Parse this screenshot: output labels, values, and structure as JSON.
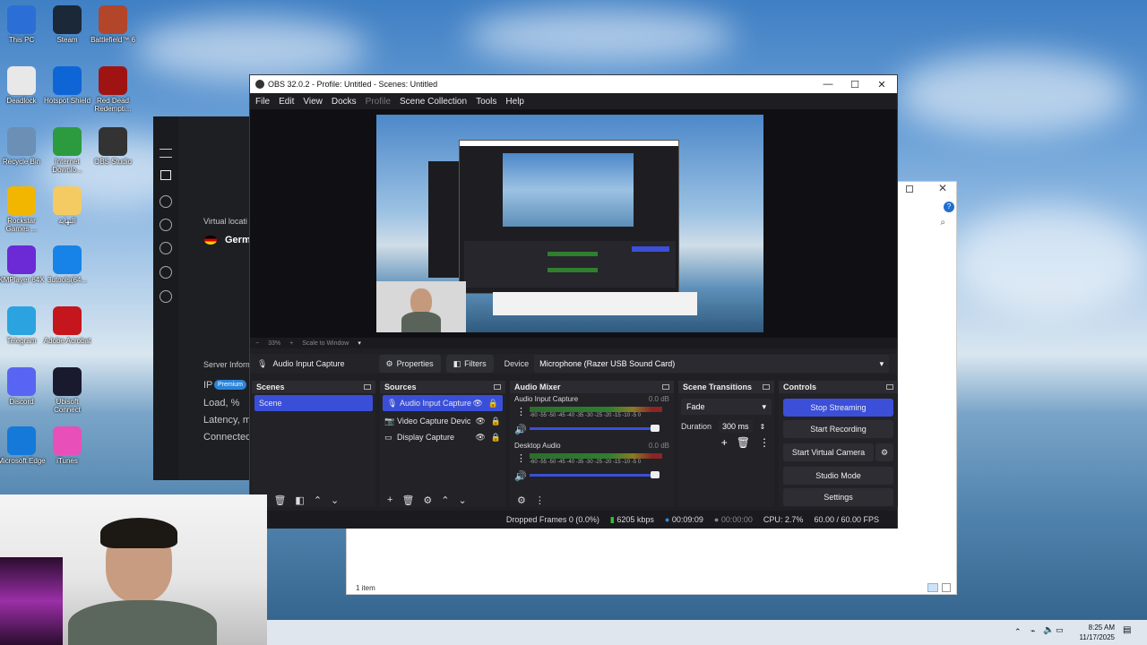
{
  "desktop": {
    "icons": [
      {
        "label": "This PC",
        "color": "#2b6fd6"
      },
      {
        "label": "Steam",
        "color": "#1b2838"
      },
      {
        "label": "Battlefield™ 6",
        "color": "#b2452a"
      },
      {
        "label": "Deadlock",
        "color": "#e8e8e8"
      },
      {
        "label": "Hotspot Shield",
        "color": "#0e65d6"
      },
      {
        "label": "Red Dead Redempti...",
        "color": "#a01313"
      },
      {
        "label": "Recycle Bin",
        "color": "#6b8fb5"
      },
      {
        "label": "Internet Downlo...",
        "color": "#2c9a3e"
      },
      {
        "label": "OBS Studio",
        "color": "#333333"
      },
      {
        "label": "Rockstar Games ...",
        "color": "#f2b600"
      },
      {
        "label": "ﺍﻟﻨﻬﺎﻳﺔ",
        "color": "#f3cb62"
      },
      {
        "label": "KMPlayer 64X",
        "color": "#6b2ad6"
      },
      {
        "label": "3utools(64...",
        "color": "#1783e8"
      },
      {
        "label": "Telegram",
        "color": "#2aa3e0"
      },
      {
        "label": "Adobe Acrobat",
        "color": "#c4161c"
      },
      {
        "label": "Discord",
        "color": "#5865f2"
      },
      {
        "label": "Ubisoft Connect",
        "color": "#1a1a2e"
      },
      {
        "label": "Microsoft Edge",
        "color": "#1479d8"
      },
      {
        "label": "iTunes",
        "color": "#e94fb8"
      }
    ]
  },
  "vpn": {
    "virtual_location": "Virtual locati",
    "country": "Germ",
    "server_info": "Server Inform",
    "ip": "IP",
    "premium": "Premium",
    "load": "Load, %",
    "latency": "Latency, m",
    "connected": "Connected"
  },
  "explorer": {
    "status": "1 item"
  },
  "obs": {
    "title": "OBS 32.0.2 - Profile: Untitled - Scenes: Untitled",
    "menu": [
      "File",
      "Edit",
      "View",
      "Docks",
      "Profile",
      "Scene Collection",
      "Tools",
      "Help"
    ],
    "zoom": "33%",
    "scale_mode": "Scale to Window",
    "selected_source": "Audio Input Capture",
    "properties": "Properties",
    "filters": "Filters",
    "device_label": "Device",
    "device_value": "Microphone (Razer USB Sound Card)",
    "scenes": {
      "title": "Scenes",
      "items": [
        "Scene"
      ]
    },
    "sources": {
      "title": "Sources",
      "items": [
        "Audio Input Capture",
        "Video Capture Devic",
        "Display Capture"
      ]
    },
    "mixer": {
      "title": "Audio Mixer",
      "channels": [
        {
          "name": "Audio Input Capture",
          "db": "0.0 dB",
          "level": 0.95
        },
        {
          "name": "Desktop Audio",
          "db": "0.0 dB",
          "level": 0.95
        }
      ],
      "scale": "-60 -55 -50 -45 -40 -35 -30 -25 -20 -15 -10 -5 0"
    },
    "transitions": {
      "title": "Scene Transitions",
      "type": "Fade",
      "duration_label": "Duration",
      "duration": "300 ms"
    },
    "controls": {
      "title": "Controls",
      "stop_streaming": "Stop Streaming",
      "start_recording": "Start Recording",
      "start_virtual_camera": "Start Virtual Camera",
      "studio_mode": "Studio Mode",
      "settings": "Settings"
    },
    "status": {
      "dropped": "Dropped Frames 0 (0.0%)",
      "bitrate": "6205 kbps",
      "stream_time": "00:09:09",
      "rec_time": "00:00:00",
      "cpu": "CPU: 2.7%",
      "fps": "60.00 / 60.00 FPS"
    }
  },
  "taskbar": {
    "time": "8:25 AM",
    "date": "11/17/2025"
  }
}
